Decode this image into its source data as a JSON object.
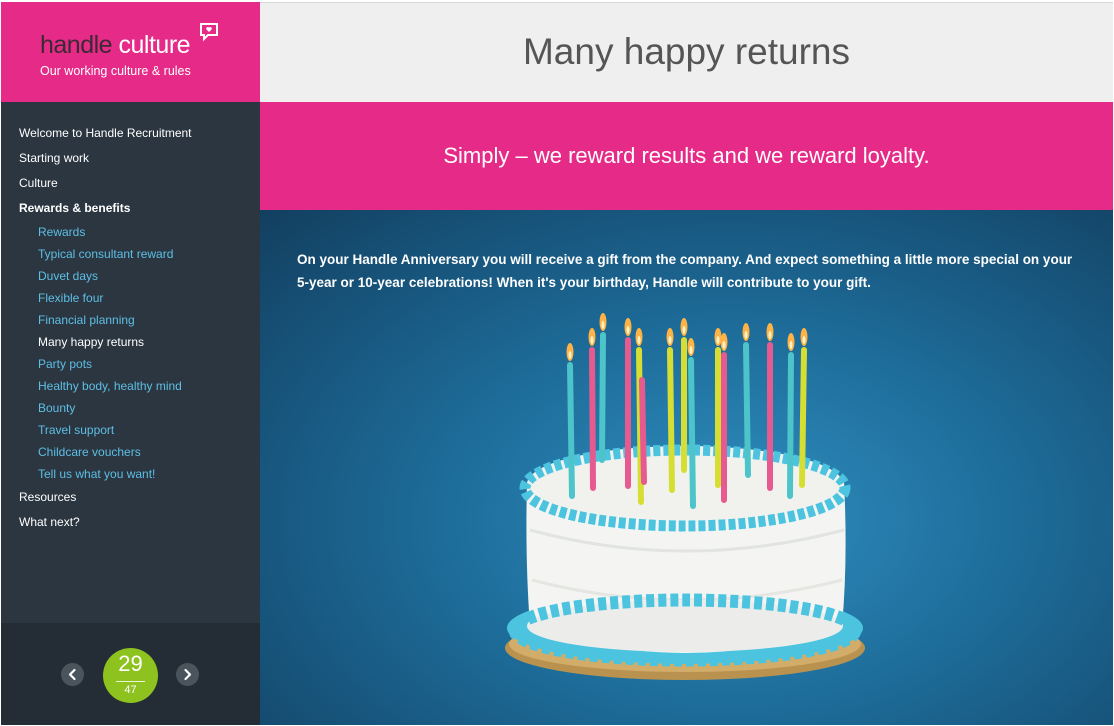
{
  "brand": {
    "name_part1": "handle",
    "name_part2": "culture",
    "tagline": "Our working culture & rules"
  },
  "sidebar": {
    "items": [
      {
        "label": "Welcome to Handle Recruitment"
      },
      {
        "label": "Starting work"
      },
      {
        "label": "Culture"
      },
      {
        "label": "Rewards & benefits"
      }
    ],
    "subitems": [
      {
        "label": "Rewards"
      },
      {
        "label": "Typical consultant reward"
      },
      {
        "label": "Duvet days"
      },
      {
        "label": "Flexible four"
      },
      {
        "label": "Financial planning"
      },
      {
        "label": "Many happy returns"
      },
      {
        "label": "Party pots"
      },
      {
        "label": "Healthy body, healthy mind"
      },
      {
        "label": "Bounty"
      },
      {
        "label": "Travel support"
      },
      {
        "label": "Childcare vouchers"
      },
      {
        "label": "Tell us what you want!"
      }
    ],
    "bottom_items": [
      {
        "label": "Resources"
      },
      {
        "label": "What next?"
      }
    ]
  },
  "pager": {
    "prev_icon": "chevron-left-icon",
    "next_icon": "chevron-right-icon",
    "current": "29",
    "total": "47"
  },
  "main": {
    "title": "Many happy returns",
    "banner": "Simply – we reward results and we reward loyalty.",
    "body": "On your Handle Anniversary you will receive a gift from the company.  And expect something a little more special on your 5-year or 10-year celebrations!  When it's your birthday, Handle will contribute to your gift."
  },
  "colors": {
    "accent": "#e62a87",
    "sidebar": "#2b3640",
    "link": "#5dbfe5",
    "badge": "#8dc21f"
  }
}
